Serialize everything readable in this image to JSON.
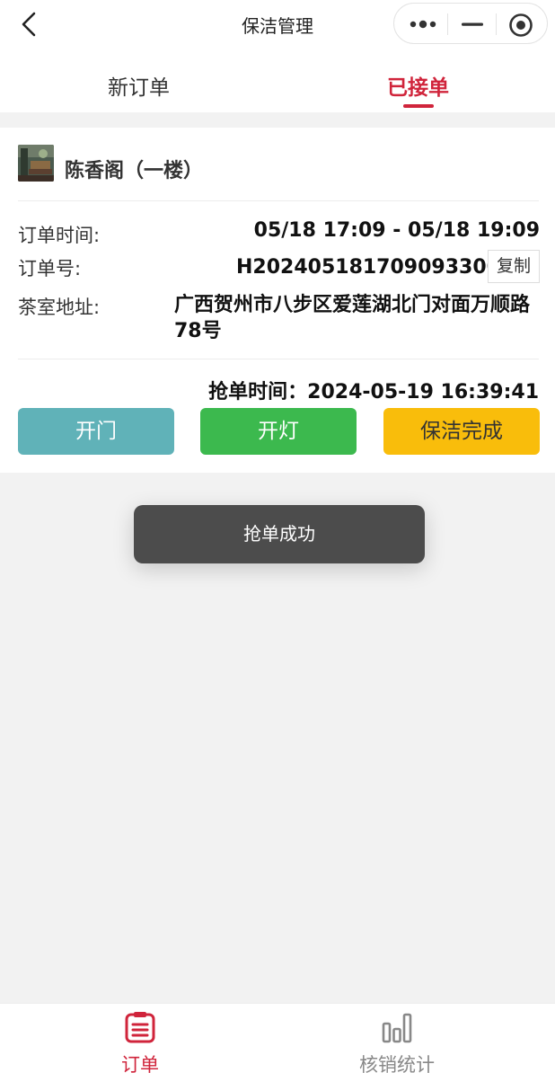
{
  "header": {
    "title": "保洁管理",
    "back_icon": "chevron-left-icon",
    "capsule": [
      "more-dots-icon",
      "minimize-icon",
      "close-target-icon"
    ]
  },
  "tabs": [
    {
      "label": "新订单",
      "active": false
    },
    {
      "label": "已接单",
      "active": true
    }
  ],
  "order": {
    "shop_name": "陈香阁（一楼）",
    "time_label": "订单时间:",
    "time_value": "05/18 17:09 - 05/18 19:09",
    "number_label": "订单号:",
    "number_value": "H202405181709093300",
    "copy_label": "复制",
    "address_label": "茶室地址:",
    "address_value": "广西贺州市八步区爱莲湖北门对面万顺路78号",
    "grab_time": "抢单时间：2024-05-19 16:39:41"
  },
  "actions": {
    "open_door": "开门",
    "light_on": "开灯",
    "cleaning_done": "保洁完成"
  },
  "toast": "抢单成功",
  "tabbar": {
    "orders": "订单",
    "stats": "核销统计"
  },
  "colors": {
    "accent": "#d0243b",
    "open_door": "#60b2b8",
    "light_on": "#3cb94e",
    "cleaning_done": "#f9bd0b"
  }
}
